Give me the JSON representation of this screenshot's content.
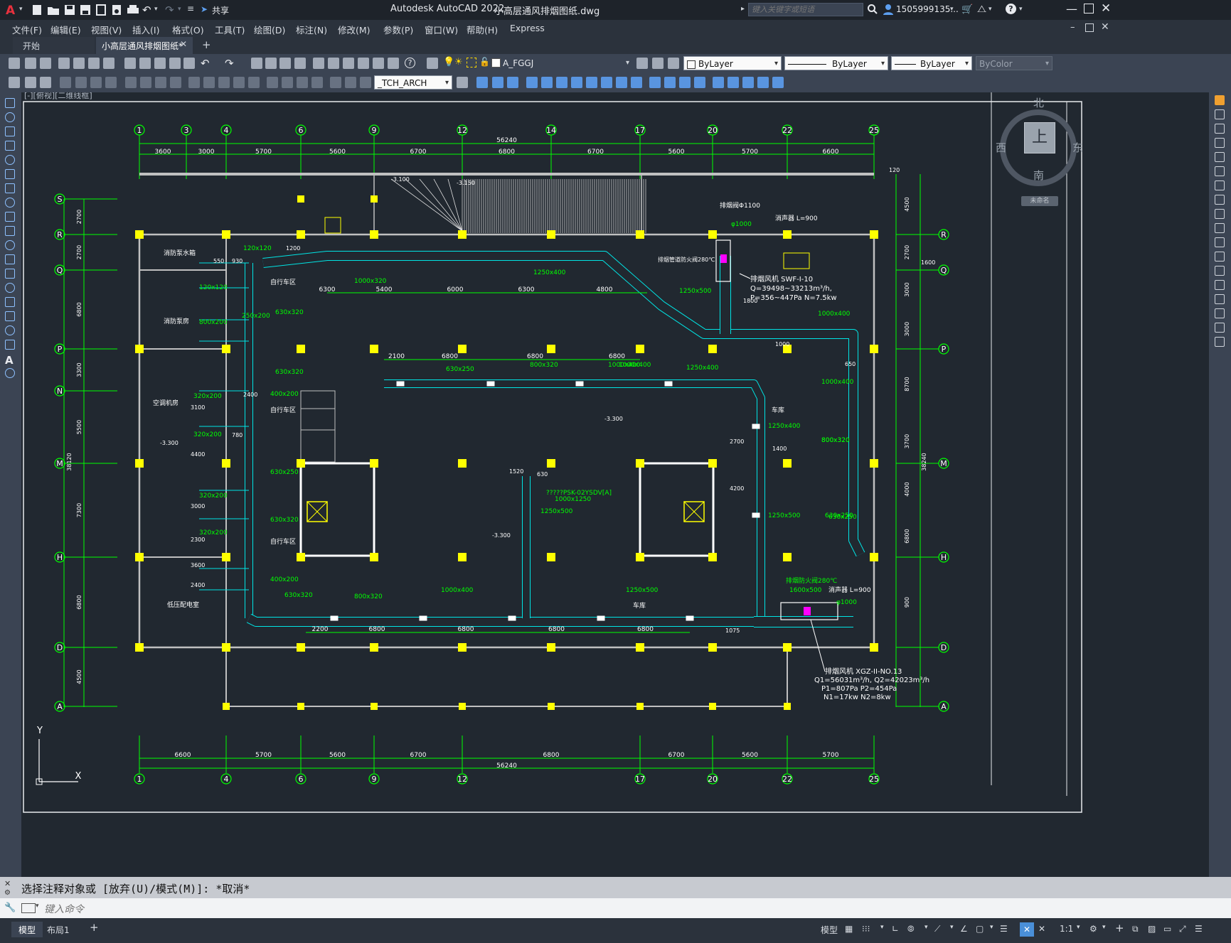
{
  "title_bar": {
    "app_title": "Autodesk AutoCAD 2022",
    "file_title": "小高层通风排烟图纸.dwg",
    "share_label": "共享",
    "search_placeholder": "键入关键字或短语",
    "user": "1505999135...",
    "window_controls": [
      "minimize-icon",
      "maximize-icon",
      "close-icon"
    ]
  },
  "menu": {
    "items": [
      "文件(F)",
      "编辑(E)",
      "视图(V)",
      "插入(I)",
      "格式(O)",
      "工具(T)",
      "绘图(D)",
      "标注(N)",
      "修改(M)",
      "参数(P)",
      "窗口(W)",
      "帮助(H)",
      "Express"
    ]
  },
  "tabs": {
    "items": [
      {
        "label": "开始",
        "active": false
      },
      {
        "label": "小高层通风排烟图纸*",
        "active": true
      }
    ],
    "add_label": "+"
  },
  "toolbar1": {
    "layer_value": "A_FGGJ",
    "color_value": "ByLayer",
    "linetype_value": "ByLayer",
    "lineweight_value": "ByLayer",
    "plotstyle_value": "ByColor"
  },
  "toolbar2": {
    "textstyle_value": "_TCH_ARCH"
  },
  "viewport": {
    "label": "[-][俯视][二维线框]"
  },
  "viewcube": {
    "north": "北",
    "south": "南",
    "east": "东",
    "west": "西",
    "face": "上",
    "wcs_label": "未命名"
  },
  "drawing": {
    "axis_top": [
      "1",
      "3",
      "4",
      "6",
      "9",
      "12",
      "14",
      "17",
      "20",
      "22",
      "25"
    ],
    "axis_bottom": [
      "1",
      "4",
      "6",
      "9",
      "12",
      "17",
      "20",
      "22",
      "25"
    ],
    "axis_left": [
      "S",
      "R",
      "Q",
      "P",
      "N",
      "M",
      "H",
      "D",
      "A"
    ],
    "axis_right": [
      "R",
      "Q",
      "P",
      "M",
      "H",
      "D",
      "A"
    ],
    "dims_top": [
      "3600",
      "3000",
      "5700",
      "5600",
      "6700",
      "6800",
      "6700",
      "5600",
      "5700",
      "6600"
    ],
    "dims_top_total": "56240",
    "dims_bottom": [
      "6600",
      "5700",
      "5600",
      "6700",
      "6800",
      "6700",
      "5600",
      "5700",
      "6600"
    ],
    "dims_bottom_total": "56240",
    "dims_left": [
      "2700",
      "2700",
      "6800",
      "3300",
      "5500",
      "7300",
      "6800",
      "4500"
    ],
    "dims_left_total": "38120",
    "dims_right": [
      "4500",
      "2700",
      "3000",
      "3000",
      "8700",
      "3700",
      "4000",
      "6800",
      "900"
    ],
    "dims_right_total": "38240",
    "dims_inner_top": [
      "6300",
      "5400",
      "6000",
      "6300",
      "4800"
    ],
    "dims_inner_mid": [
      "2100",
      "6800",
      "6800",
      "6800"
    ],
    "dims_inner_bottom": [
      "2200",
      "6800",
      "6800",
      "6800",
      "6800"
    ],
    "room_labels": [
      "消防泵水箱",
      "消防泵房",
      "空调机房",
      "低压配电室",
      "自行车区",
      "自行车区",
      "自行车区",
      "车库",
      "车库"
    ],
    "duct_labels": [
      "1250x400",
      "1250x500",
      "1000x400",
      "1000x400",
      "800x320",
      "630x250",
      "1000x320",
      "630x320",
      "250x200",
      "630x320",
      "400x200",
      "630x250",
      "630x320",
      "400x200",
      "630x320",
      "800x320",
      "1000x400",
      "1250x500",
      "630x250",
      "800x320",
      "1000x400",
      "1250x400",
      "1250x400",
      "1250x500",
      "1000x400",
      "800x320",
      "630x250",
      "1250x500",
      "1600x500",
      "120x120",
      "120x120",
      "800x200",
      "320x200",
      "320x200",
      "320x200",
      "320x200",
      "1000x1250"
    ],
    "level_labels": [
      "-3.100",
      "-3.150",
      "-3.300",
      "-3.300",
      "-3.300"
    ],
    "misc_labels": [
      "1200",
      "930",
      "2400",
      "780",
      "1800",
      "1000",
      "650",
      "1520",
      "630",
      "1400",
      "2700",
      "4200",
      "1075",
      "3100",
      "4400",
      "3000",
      "2300",
      "2400",
      "3600",
      "550",
      "1600",
      "120"
    ],
    "equip_top": {
      "title": "排烟风机 SWF-I-10",
      "line1": "Q=39498~33213m³/h,",
      "line2": "P=356~447Pa  N=7.5kw",
      "muffler": "消声器 L=900",
      "duct": "φ1000",
      "valve": "排烟阀Φ1100",
      "note": "排烟管道防火阀280℃"
    },
    "equip_bottom": {
      "title": "排烟风机 XGZ-II-NO.13",
      "line1": "Q1=56031m³/h, Q2=42023m³/h",
      "line2": "P1=807Pa    P2=454Pa",
      "line3": "N1=17kw    N2=8kw",
      "muffler": "消声器 L=900",
      "duct": "φ1000",
      "valve": "排烟防火阀280℃"
    },
    "psk_label": "?????PSK-02YSDV[A]",
    "ucs_y": "Y",
    "ucs_x": "X"
  },
  "command": {
    "history": "选择注释对象或 [放弃(U)/模式(M)]: *取消*",
    "placeholder": "键入命令"
  },
  "layout_tabs": {
    "items": [
      "模型",
      "布局1"
    ],
    "add_label": "+"
  },
  "status": {
    "model_label": "模型",
    "scale": "1:1"
  },
  "colors": {
    "title_bg": "#1e232a",
    "toolbar_bg": "#3b4453",
    "canvas_bg": "#212830",
    "grid_green": "#00ff00",
    "duct_cyan": "#00e5e5",
    "column_yellow": "#ffff00",
    "wall_gray": "#c0c0c0",
    "magenta": "#ff00ff"
  }
}
